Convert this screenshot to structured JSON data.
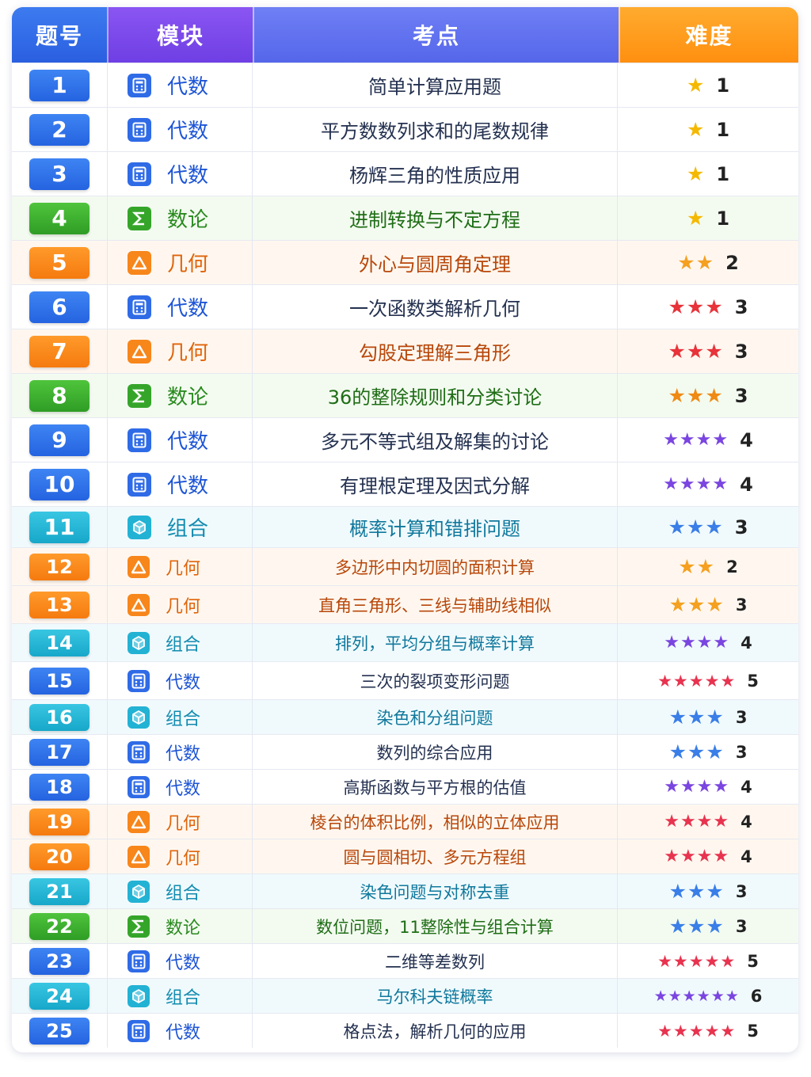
{
  "header": {
    "col_no": "题号",
    "col_module": "模块",
    "col_topic": "考点",
    "col_difficulty": "难度"
  },
  "colors": {
    "algebra": "#2f6be6",
    "number_theory": "#35a52a",
    "geometry": "#f7861b",
    "combinatorics": "#22b2d4"
  },
  "icons": {
    "algebra": "calculator-icon",
    "number_theory": "sigma-icon",
    "geometry": "triangle-icon",
    "combinatorics": "cube-icon",
    "difficulty": "star-icon"
  },
  "rows": [
    {
      "no": "1",
      "module": "代数",
      "type": "alg",
      "topic": "简单计算应用题",
      "stars": "★",
      "star_color": "#f5b800",
      "difficulty": "1"
    },
    {
      "no": "2",
      "module": "代数",
      "type": "alg",
      "topic": "平方数数列求和的尾数规律",
      "stars": "★",
      "star_color": "#f5b800",
      "difficulty": "1"
    },
    {
      "no": "3",
      "module": "代数",
      "type": "alg",
      "topic": "杨辉三角的性质应用",
      "stars": "★",
      "star_color": "#f5b800",
      "difficulty": "1"
    },
    {
      "no": "4",
      "module": "数论",
      "type": "nt",
      "topic": "进制转换与不定方程",
      "stars": "★",
      "star_color": "#f5b800",
      "difficulty": "1"
    },
    {
      "no": "5",
      "module": "几何",
      "type": "geo",
      "topic": "外心与圆周角定理",
      "stars": "★★",
      "star_color": "#f5a020",
      "difficulty": "2"
    },
    {
      "no": "6",
      "module": "代数",
      "type": "alg",
      "topic": "一次函数类解析几何",
      "stars": "★★★",
      "star_color": "#e8333a",
      "difficulty": "3"
    },
    {
      "no": "7",
      "module": "几何",
      "type": "geo",
      "topic": "勾股定理解三角形",
      "stars": "★★★",
      "star_color": "#e8333a",
      "difficulty": "3"
    },
    {
      "no": "8",
      "module": "数论",
      "type": "nt",
      "topic": "36的整除规则和分类讨论",
      "stars": "★★★",
      "star_color": "#f08a14",
      "difficulty": "3"
    },
    {
      "no": "9",
      "module": "代数",
      "type": "alg",
      "topic": "多元不等式组及解集的讨论",
      "stars": "★★★★",
      "star_color": "#7a45e0",
      "difficulty": "4"
    },
    {
      "no": "10",
      "module": "代数",
      "type": "alg",
      "topic": "有理根定理及因式分解",
      "stars": "★★★★",
      "star_color": "#7a45e0",
      "difficulty": "4"
    },
    {
      "no": "11",
      "module": "组合",
      "type": "cmb",
      "topic": "概率计算和错排问题",
      "stars": "★★★",
      "star_color": "#3a7ee8",
      "difficulty": "3"
    },
    {
      "no": "12",
      "module": "几何",
      "type": "geo",
      "topic": "多边形中内切圆的面积计算",
      "stars": "★★",
      "star_color": "#f5a020",
      "difficulty": "2"
    },
    {
      "no": "13",
      "module": "几何",
      "type": "geo",
      "topic": "直角三角形、三线与辅助线相似",
      "stars": "★★★",
      "star_color": "#f5a020",
      "difficulty": "3"
    },
    {
      "no": "14",
      "module": "组合",
      "type": "cmb",
      "topic": "排列，平均分组与概率计算",
      "stars": "★★★★",
      "star_color": "#7a45e0",
      "difficulty": "4"
    },
    {
      "no": "15",
      "module": "代数",
      "type": "alg",
      "topic": "三次的裂项变形问题",
      "stars": "★★★★★",
      "star_color": "#e8334f",
      "difficulty": "5"
    },
    {
      "no": "16",
      "module": "组合",
      "type": "cmb",
      "topic": "染色和分组问题",
      "stars": "★★★",
      "star_color": "#3a7ee8",
      "difficulty": "3"
    },
    {
      "no": "17",
      "module": "代数",
      "type": "alg",
      "topic": "数列的综合应用",
      "stars": "★★★",
      "star_color": "#3a7ee8",
      "difficulty": "3"
    },
    {
      "no": "18",
      "module": "代数",
      "type": "alg",
      "topic": "高斯函数与平方根的估值",
      "stars": "★★★★",
      "star_color": "#7a45e0",
      "difficulty": "4"
    },
    {
      "no": "19",
      "module": "几何",
      "type": "geo",
      "topic": "棱台的体积比例，相似的立体应用",
      "stars": "★★★★",
      "star_color": "#e8334f",
      "difficulty": "4"
    },
    {
      "no": "20",
      "module": "几何",
      "type": "geo",
      "topic": "圆与圆相切、多元方程组",
      "stars": "★★★★",
      "star_color": "#e8334f",
      "difficulty": "4"
    },
    {
      "no": "21",
      "module": "组合",
      "type": "cmb",
      "topic": "染色问题与对称去重",
      "stars": "★★★",
      "star_color": "#3a7ee8",
      "difficulty": "3"
    },
    {
      "no": "22",
      "module": "数论",
      "type": "nt",
      "topic": "数位问题，11整除性与组合计算",
      "stars": "★★★",
      "star_color": "#3a7ee8",
      "difficulty": "3"
    },
    {
      "no": "23",
      "module": "代数",
      "type": "alg",
      "topic": "二维等差数列",
      "stars": "★★★★★",
      "star_color": "#e8334f",
      "difficulty": "5"
    },
    {
      "no": "24",
      "module": "组合",
      "type": "cmb",
      "topic": "马尔科夫链概率",
      "stars": "★★★★★★",
      "star_color": "#7a45e0",
      "difficulty": "6"
    },
    {
      "no": "25",
      "module": "代数",
      "type": "alg",
      "topic": "格点法，解析几何的应用",
      "stars": "★★★★★",
      "star_color": "#e8334f",
      "difficulty": "5"
    }
  ]
}
